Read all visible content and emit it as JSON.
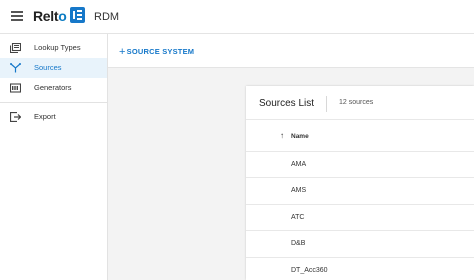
{
  "header": {
    "brand": "Relt",
    "brand_tail": "o",
    "app_name": "RDM"
  },
  "sidebar": {
    "items": [
      {
        "label": "Lookup Types",
        "icon": "lookup-types-icon"
      },
      {
        "label": "Sources",
        "icon": "sources-icon",
        "active": true
      },
      {
        "label": "Generators",
        "icon": "generators-icon"
      },
      {
        "label": "Export",
        "icon": "export-icon"
      }
    ]
  },
  "toolbar": {
    "add_source_label": "SOURCE SYSTEM",
    "add_source_plus": "+"
  },
  "sources_panel": {
    "title": "Sources List",
    "count": "12 sources",
    "column_name": "Name",
    "sort_indicator": "↑",
    "rows": [
      "AMA",
      "AMS",
      "ATC",
      "D&B",
      "DT_Acc360"
    ]
  },
  "colors": {
    "accent": "#1678c9",
    "active_bg": "#e8f3fb",
    "main_bg": "#f3f3f3"
  }
}
